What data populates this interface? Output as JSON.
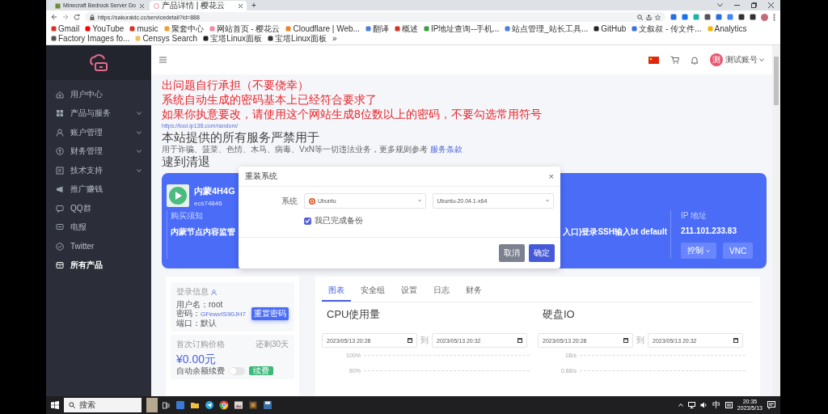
{
  "browser": {
    "tabs": [
      {
        "title": "Minecraft Bedrock Server Do",
        "selected": false
      },
      {
        "title": "产品详情 | 樱花云",
        "selected": true
      }
    ],
    "new_tab": "+",
    "url": "https://sakuraidc.cc/servicedetail?id=888",
    "bookmarks": [
      "Gmail",
      "YouTube",
      "music",
      "聚套中心",
      "网站首页 - 樱花云",
      "Cloudflare | Web...",
      "翻译",
      "概述",
      "IP地址查询--手机...",
      "站点管理_站长工具...",
      "GitHub",
      "文叙叔 - 传文件...",
      "Analytics",
      "Factory Images fo...",
      "Censys Search",
      "宝塔Linux面板",
      "宝塔Linux面板",
      "»"
    ]
  },
  "sidebar": {
    "items": [
      {
        "label": "用户中心",
        "expandable": false,
        "selected": false
      },
      {
        "label": "产品与服务",
        "expandable": true,
        "selected": false
      },
      {
        "label": "账户管理",
        "expandable": true,
        "selected": false
      },
      {
        "label": "财务管理",
        "expandable": true,
        "selected": false
      },
      {
        "label": "技术支持",
        "expandable": true,
        "selected": false
      },
      {
        "label": "推广赚钱",
        "expandable": false,
        "selected": false
      },
      {
        "label": "QQ群",
        "expandable": false,
        "selected": false
      },
      {
        "label": "电报",
        "expandable": false,
        "selected": false
      },
      {
        "label": "Twitter",
        "expandable": false,
        "selected": false
      },
      {
        "label": "所有产品",
        "expandable": false,
        "selected": true
      }
    ]
  },
  "header": {
    "avatar_text": "测",
    "account": "测试账号"
  },
  "notice": {
    "red_lines": [
      "出问题自行承担（不要侥幸）",
      "系统自动生成的密码基本上已经符合要求了",
      "如果你执意要改，请使用这个网站生成8位数以上的密码，不要勾选常用符号"
    ],
    "link": "https://tool.ip138.com/random/",
    "heading": "本站提供的所有服务严禁用于",
    "body": "用于诈骗、菠菜、色情、木马、病毒、VxN等一切违法业务，更多规则参考",
    "body_link": "服务条款",
    "closing": "逮到清退"
  },
  "product_card": {
    "name": "内蒙4H4G",
    "id": "ecs74846",
    "notice_label": "购买须知",
    "notice_left": "内蒙节点内容监管",
    "notice_right": "入口)登录SSH输入bt default",
    "ip_label": "IP 地址",
    "ip": "211.101.233.83",
    "control_button": "控制",
    "vnc_button": "VNC"
  },
  "modal": {
    "title": "重装系统",
    "close": "×",
    "field_label": "系统",
    "os": "Ubuntu",
    "version": "Ubuntu-20.04.1-x64",
    "backup_checkbox": {
      "label": "我已完成备份",
      "checked": true
    },
    "buttons": [
      {
        "label": "取消",
        "kind": "secondary"
      },
      {
        "label": "确定",
        "kind": "primary"
      }
    ]
  },
  "login_info": {
    "title": "登录信息",
    "username_label": "用户名：",
    "username": "root",
    "password_label": "密码：",
    "password": "GFewvIS90JH7",
    "port_label": "端口：",
    "port": "默认",
    "reset_button": "重置密码"
  },
  "billing": {
    "title": "首次订购价格",
    "remaining": "还剩30天",
    "price": "¥0.00元",
    "auto_renew": {
      "label": "自动余额续费",
      "on": false
    },
    "renew_button": "续费"
  },
  "detail": {
    "tabs": [
      {
        "label": "图表",
        "selected": true
      },
      {
        "label": "安全组",
        "selected": false
      },
      {
        "label": "设置",
        "selected": false
      },
      {
        "label": "日志",
        "selected": false
      },
      {
        "label": "财务",
        "selected": false
      }
    ],
    "panels": [
      {
        "title": "CPU使用量",
        "from": "2023/05/13 20:28",
        "to_label": "到",
        "to": "2023/05/13 20:32",
        "axis_labels": [
          "100%",
          "80%"
        ]
      },
      {
        "title": "硬盘IO",
        "from": "2023/05/13 20:28",
        "to_label": "到",
        "to": "2023/05/13 20:32",
        "axis_labels": [
          "1B/s",
          "0.88/s"
        ]
      }
    ]
  },
  "taskbar": {
    "search": "搜索",
    "ime": "中",
    "time": "20:35",
    "date": "2023/5/13"
  }
}
